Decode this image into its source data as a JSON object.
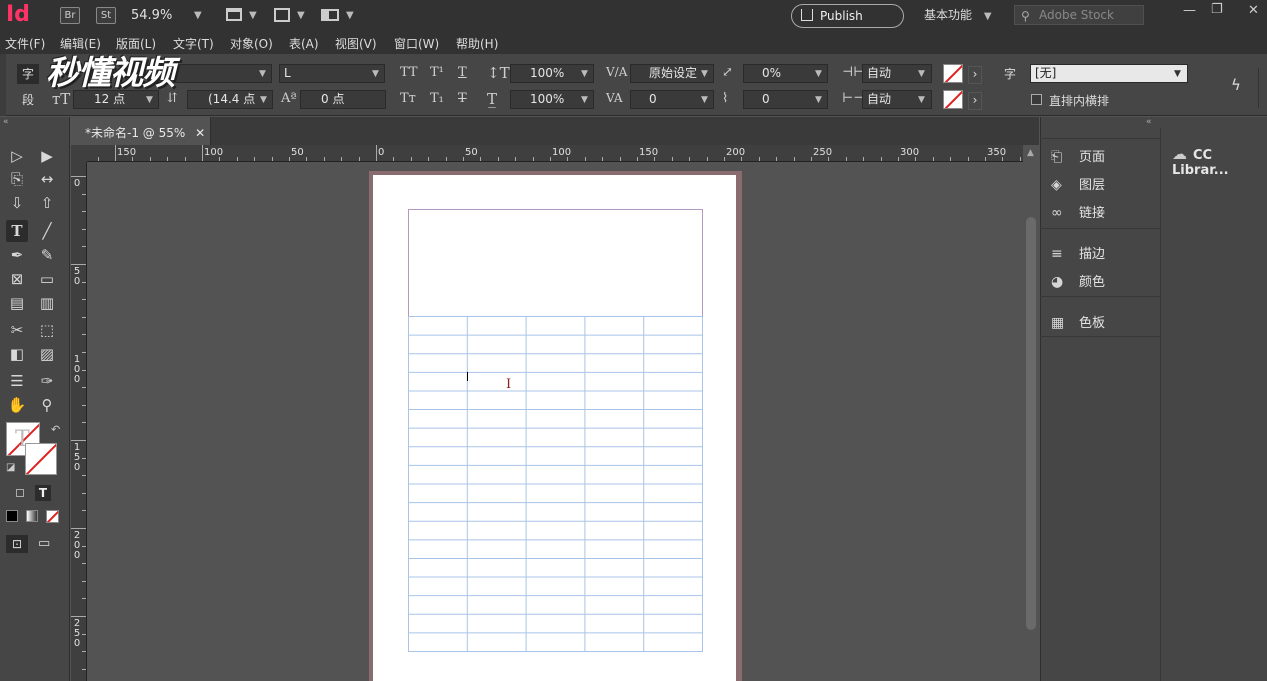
{
  "app": {
    "logo": "Id",
    "bridge": "Br",
    "stock_btn": "St",
    "zoom": "54.9%",
    "publish": "Publish Online",
    "workspace": "基本功能",
    "search_placeholder": "Adobe Stock",
    "watermark": "秒懂视频"
  },
  "menu": [
    "文件(F)",
    "编辑(E)",
    "版面(L)",
    "文字(T)",
    "对象(O)",
    "表(A)",
    "视图(V)",
    "窗口(W)",
    "帮助(H)"
  ],
  "control": {
    "font_style": "L",
    "font_size": "12 点",
    "leading": "(14.4 点",
    "baseline": "0 点",
    "vscale": "100%",
    "hscale": "100%",
    "kerning": "原始设定",
    "tracking": "0",
    "skew": "0%",
    "rotate": "0",
    "auto1": "自动",
    "auto2": "自动",
    "char_style_label": "字",
    "char_style": "[无]",
    "tate_chu_yoko": "直排内横排",
    "para_label": "段"
  },
  "document": {
    "tab_title": "*未命名-1 @ 55%",
    "rows": 18,
    "cols": 5
  },
  "ruler": {
    "h_labels": [
      "150",
      "100",
      "50",
      "0",
      "50",
      "100",
      "150",
      "200",
      "250",
      "300",
      "350"
    ],
    "v_labels": [
      "0",
      "50",
      "100",
      "150",
      "200",
      "250"
    ]
  },
  "panels": [
    {
      "icon": "pages-icon",
      "label": "页面"
    },
    {
      "icon": "layers-icon",
      "label": "图层"
    },
    {
      "icon": "links-icon",
      "label": "链接"
    },
    {
      "icon": "stroke-icon",
      "label": "描边"
    },
    {
      "icon": "color-icon",
      "label": "颜色"
    },
    {
      "icon": "swatches-icon",
      "label": "色板"
    }
  ],
  "cc_libraries": "CC Librar...",
  "colors": {
    "accent": "#ff3366",
    "table_line": "#a9c4e8",
    "frame": "#b598c0"
  }
}
